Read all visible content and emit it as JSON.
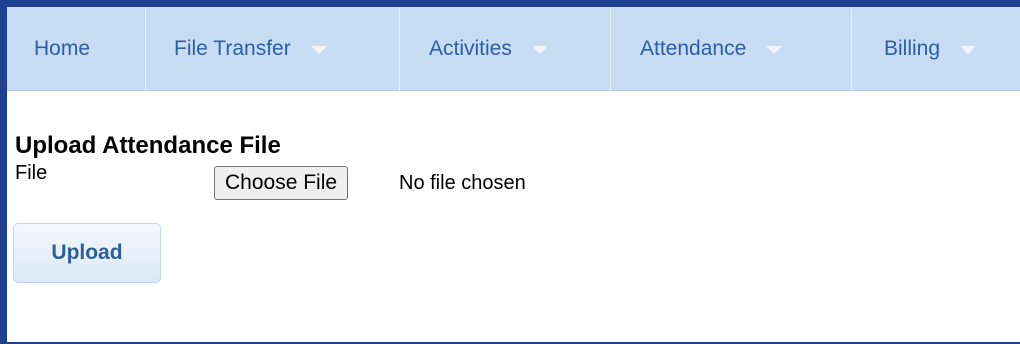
{
  "nav": {
    "items": [
      {
        "label": "Home",
        "has_dropdown": false
      },
      {
        "label": "File Transfer",
        "has_dropdown": true
      },
      {
        "label": "Activities",
        "has_dropdown": true
      },
      {
        "label": "Attendance",
        "has_dropdown": true
      },
      {
        "label": "Billing",
        "has_dropdown": true
      }
    ]
  },
  "main": {
    "heading": "Upload Attendance File",
    "file_label": "File",
    "choose_button": "Choose File",
    "no_file_text": "No file chosen",
    "upload_button": "Upload"
  },
  "colors": {
    "frame_border": "#1f3f8f",
    "nav_background": "#c8dcf3",
    "nav_text": "#2c5ea8",
    "upload_text": "#2d5f99"
  }
}
